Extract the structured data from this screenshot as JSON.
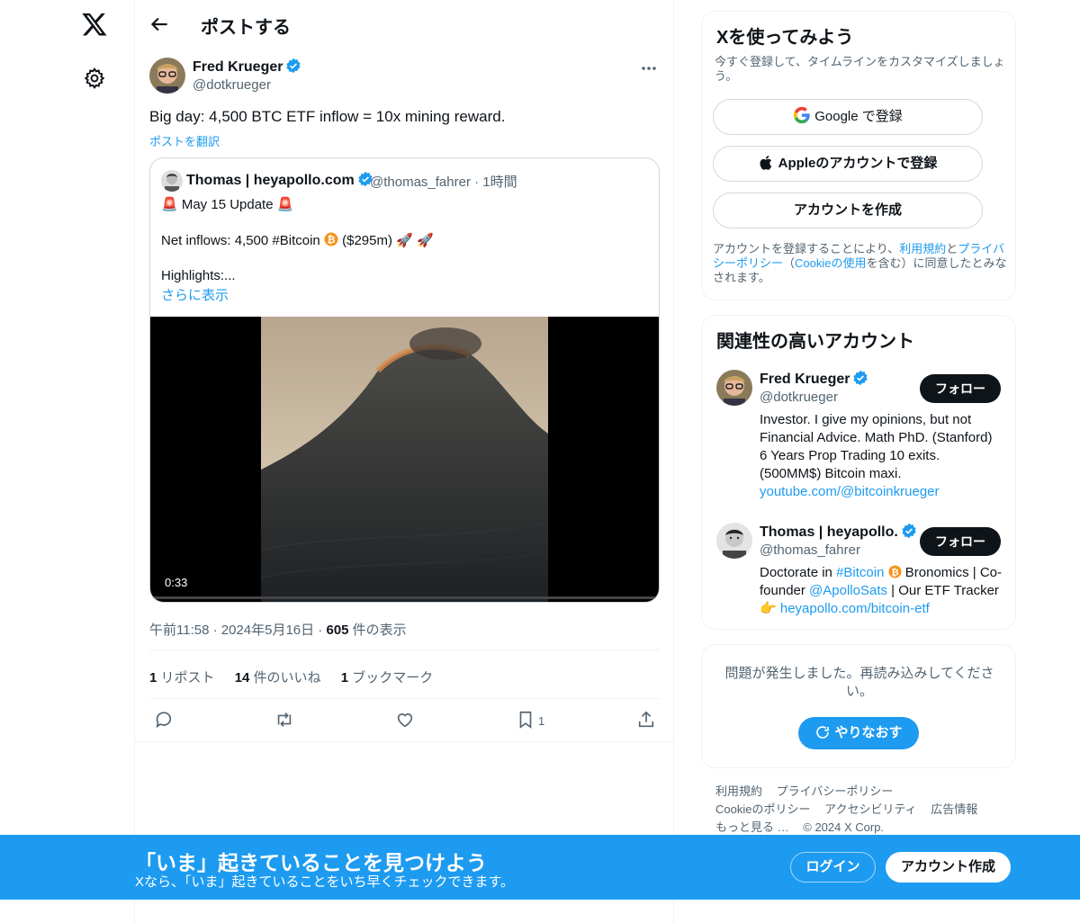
{
  "colors": {
    "accent": "#1d9bf0",
    "text": "#0f1419",
    "muted": "#536471",
    "bitcoin": "#f7931a"
  },
  "header": {
    "title": "ポストする"
  },
  "post": {
    "author_name": "Fred Krueger",
    "author_handle": "@dotkrueger",
    "text": "Big day: 4,500 BTC ETF inflow = 10x mining reward.",
    "translate_label": "ポストを翻訳",
    "quote": {
      "author_name": "Thomas | heyapollo.com",
      "author_handle": "@thomas_fahrer",
      "separator": "·",
      "time": "1時間",
      "line1": "🚨 May 15 Update 🚨",
      "line2_prefix": "Net inflows: 4,500 #Bitcoin",
      "line2_suffix": " ($295m) 🚀 🚀",
      "line3": "Highlights:...",
      "show_more": "さらに表示",
      "video_time": "0:33"
    },
    "timestamp": "午前11:58 · 2024年5月16日 · ",
    "views_count": "605",
    "views_label": " 件の表示",
    "stats": {
      "reposts_count": "1",
      "reposts_label": " リポスト",
      "likes_count": "14",
      "likes_label": " 件のいいね",
      "bookmarks_count": "1",
      "bookmarks_label": " ブックマーク"
    },
    "bookmark_action_count": "1"
  },
  "signup_card": {
    "title": "Xを使ってみよう",
    "subtitle": "今すぐ登録して、タイムラインをカスタマイズしましょう。",
    "google_label": "Google で登録",
    "apple_label": "Appleのアカウントで登録",
    "create_label": "アカウントを作成",
    "terms_1": "アカウントを登録することにより、",
    "terms_link1": "利用規約",
    "terms_2": "と",
    "terms_link2": "プライバシーポリシー",
    "terms_3": "（",
    "terms_link3": "Cookieの使用",
    "terms_4": "を含む）に同意したとみなされます。"
  },
  "related_card": {
    "title": "関連性の高いアカウント",
    "follow_label": "フォロー",
    "accounts": [
      {
        "name": "Fred Krueger",
        "handle": "@dotkrueger",
        "bio": "Investor. I give my opinions, but not Financial Advice. Math PhD. (Stanford) 6 Years Prop Trading 10 exits. (500MM$) Bitcoin maxi.",
        "link": "youtube.com/@bitcoinkrueger"
      },
      {
        "name": "Thomas | heyapollo.",
        "handle": "@thomas_fahrer",
        "bio_1": "Doctorate in ",
        "bio_tag": "#Bitcoin",
        "bio_2": " Bronomics | Co-founder ",
        "bio_mention": "@ApolloSats",
        "bio_3": " | Our ETF Tracker 👉 ",
        "link": "heyapollo.com/bitcoin-etf"
      }
    ]
  },
  "error_card": {
    "message": "問題が発生しました。再読み込みしてください。",
    "retry_label": "やりなおす"
  },
  "footer": {
    "links": [
      "利用規約",
      "プライバシーポリシー",
      "Cookieのポリシー",
      "アクセシビリティ",
      "広告情報",
      "もっと見る …",
      "© 2024 X Corp."
    ]
  },
  "banner": {
    "title": "「いま」起きていることを見つけよう",
    "subtitle": "Xなら、「いま」起きていることをいち早くチェックできます。",
    "login_label": "ログイン",
    "signup_label": "アカウント作成"
  }
}
